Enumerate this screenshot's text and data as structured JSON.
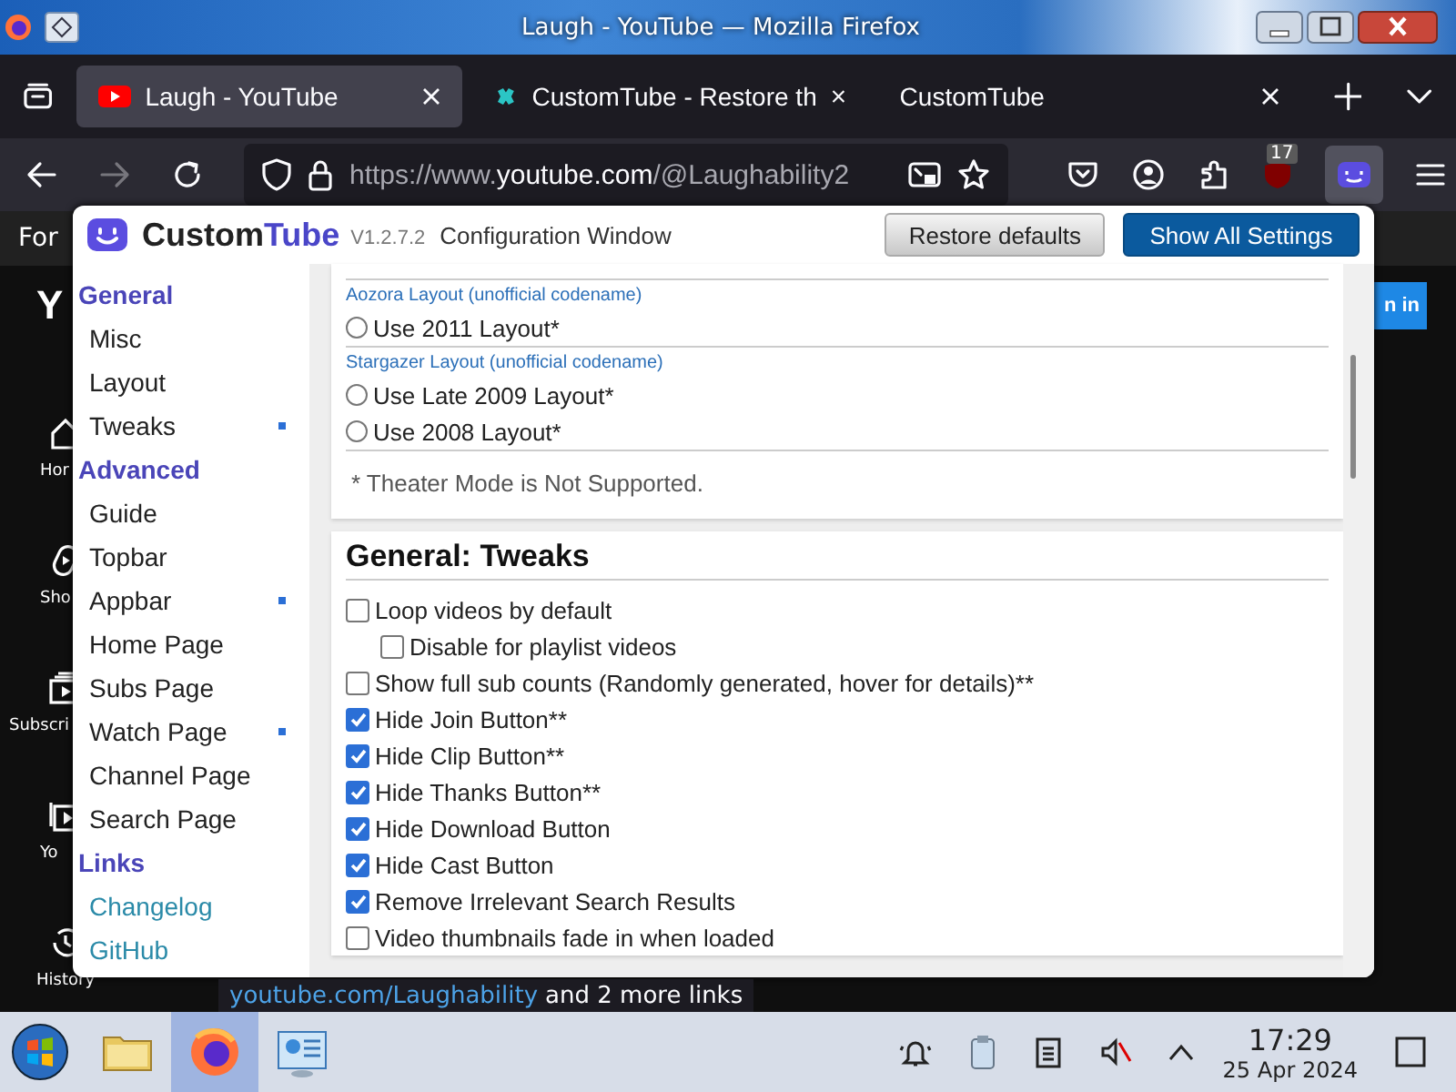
{
  "os_window": {
    "title": "Laugh - YouTube — Mozilla Firefox"
  },
  "tabs": [
    {
      "label": "Laugh - YouTube",
      "selected": true
    },
    {
      "label": "CustomTube - Restore th",
      "selected": false
    },
    {
      "label": "CustomTube",
      "selected": false
    }
  ],
  "toolbar": {
    "url": {
      "scheme": "https://www.",
      "domain": "youtube.com",
      "path": "/@Laughability2"
    },
    "extension_badge": "17"
  },
  "page_behind": {
    "banner": "For",
    "logo_fragment": "Y",
    "sign_in": "n in",
    "nav": [
      {
        "label": "Hor"
      },
      {
        "label": "Sho"
      },
      {
        "label": "Subscri"
      },
      {
        "label": "Yo"
      },
      {
        "label": "History"
      }
    ]
  },
  "config": {
    "brand": {
      "custom": "Custom",
      "tube": "Tube"
    },
    "version": "V1.2.7.2",
    "title": "Configuration Window",
    "buttons": [
      {
        "label": "Restore defaults",
        "kind": "secondary"
      },
      {
        "label": "Show All Settings",
        "kind": "primary"
      }
    ],
    "sidebar": [
      {
        "heading": "General",
        "kind": "pages",
        "items": [
          {
            "label": "Misc",
            "modified": false
          },
          {
            "label": "Layout",
            "modified": false
          },
          {
            "label": "Tweaks",
            "modified": true
          }
        ]
      },
      {
        "heading": "Advanced",
        "kind": "pages",
        "items": [
          {
            "label": "Guide",
            "modified": false
          },
          {
            "label": "Topbar",
            "modified": false
          },
          {
            "label": "Appbar",
            "modified": true
          },
          {
            "label": "Home Page",
            "modified": false
          },
          {
            "label": "Subs Page",
            "modified": false
          },
          {
            "label": "Watch Page",
            "modified": true
          },
          {
            "label": "Channel Page",
            "modified": false
          },
          {
            "label": "Search Page",
            "modified": false
          }
        ]
      },
      {
        "heading": "Links",
        "kind": "links",
        "items": [
          {
            "label": "Changelog",
            "modified": false
          },
          {
            "label": "GitHub",
            "modified": false
          }
        ]
      }
    ],
    "layout_section": {
      "groups": [
        {
          "caption": "Aozora Layout (unofficial codename)",
          "options": [
            {
              "label": "Use 2011 Layout*",
              "selected": false
            }
          ]
        },
        {
          "caption": "Stargazer Layout (unofficial codename)",
          "options": [
            {
              "label": "Use Late 2009 Layout*",
              "selected": false
            },
            {
              "label": "Use 2008 Layout*",
              "selected": false
            }
          ]
        }
      ],
      "note": "* Theater Mode is Not Supported."
    },
    "tweaks_section": {
      "title": "General: Tweaks",
      "options": [
        {
          "label": "Loop videos by default",
          "checked": false,
          "children": [
            {
              "label": "Disable for playlist videos",
              "checked": false
            }
          ]
        },
        {
          "label": "Show full sub counts (Randomly generated, hover for details)**",
          "checked": false
        },
        {
          "label": "Hide Join Button**",
          "checked": true
        },
        {
          "label": "Hide Clip Button**",
          "checked": true
        },
        {
          "label": "Hide Thanks Button**",
          "checked": true
        },
        {
          "label": "Hide Download Button",
          "checked": true
        },
        {
          "label": "Hide Cast Button",
          "checked": true
        },
        {
          "label": "Remove Irrelevant Search Results",
          "checked": true
        },
        {
          "label": "Video thumbnails fade in when loaded",
          "checked": false
        }
      ]
    }
  },
  "status_link": {
    "link": "youtube.com/Laughability",
    "rest": "and 2 more links"
  },
  "taskbar": {
    "apps": [
      {
        "selected": false
      },
      {
        "selected": true
      },
      {
        "selected": false
      }
    ],
    "time": "17:29",
    "date": "25 Apr 2024"
  }
}
